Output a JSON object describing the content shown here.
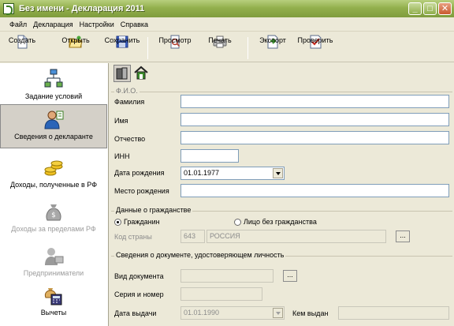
{
  "window": {
    "title": "Без имени - Декларация 2011"
  },
  "menu": [
    "Файл",
    "Декларация",
    "Настройки",
    "Справка"
  ],
  "toolbar": {
    "create": "Создать",
    "open": "Открыть",
    "save": "Сохранить",
    "preview": "Просмотр",
    "print": "Печать",
    "export": "Экспорт",
    "check": "Проверить"
  },
  "nav": [
    {
      "label": "Задание условий",
      "icon": "conditions-tree-icon"
    },
    {
      "label": "Сведения о декларанте",
      "icon": "declarant-person-icon"
    },
    {
      "label": "Доходы, полученные в РФ",
      "icon": "income-coins-icon"
    },
    {
      "label": "Доходы за пределами РФ",
      "icon": "foreign-income-bag-icon"
    },
    {
      "label": "Предприниматели",
      "icon": "entrepreneurs-icon"
    },
    {
      "label": "Вычеты",
      "icon": "deductions-icon"
    }
  ],
  "fio": {
    "title": "Ф.И.О.",
    "surname_label": "Фамилия",
    "name_label": "Имя",
    "patronymic_label": "Отчество",
    "inn_label": "ИНН",
    "birthdate_label": "Дата рождения",
    "birthdate_value": "01.01.1977",
    "birthplace_label": "Место рождения"
  },
  "citizenship": {
    "title": "Данные о гражданстве",
    "option_citizen": "Гражданин",
    "option_stateless": "Лицо без гражданства",
    "country_code_label": "Код страны",
    "country_code": "643",
    "country_name": "РОССИЯ"
  },
  "document": {
    "title": "Сведения о документе, удостоверяющем личность",
    "doc_type_label": "Вид документа",
    "series_label": "Серия и номер",
    "issue_date_label": "Дата выдачи",
    "issue_date_value": "01.01.1990",
    "issued_by_label": "Кем выдан"
  }
}
